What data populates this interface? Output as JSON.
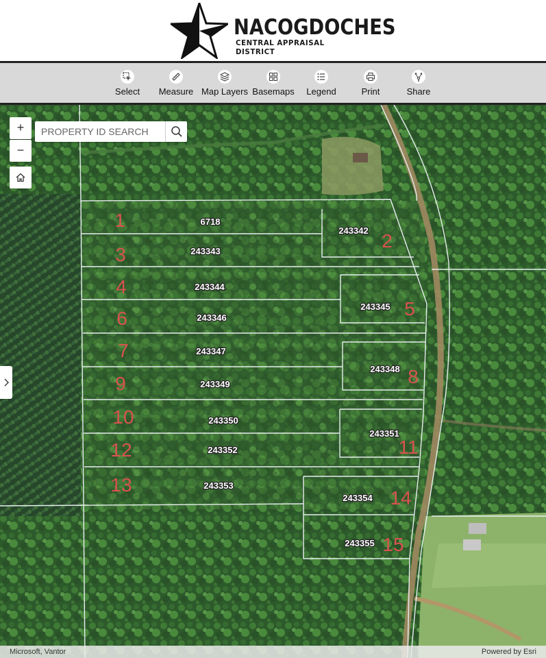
{
  "header": {
    "logo_title": "NACOGDOCHES",
    "logo_subtitle": "CENTRAL APPRAISAL DISTRICT",
    "logo_icon": "texas-star-icon"
  },
  "toolbar": {
    "items": [
      {
        "label": "Select",
        "icon": "select-icon"
      },
      {
        "label": "Measure",
        "icon": "ruler-icon"
      },
      {
        "label": "Map Layers",
        "icon": "layers-icon"
      },
      {
        "label": "Basemaps",
        "icon": "grid-icon"
      },
      {
        "label": "Legend",
        "icon": "list-icon"
      },
      {
        "label": "Print",
        "icon": "printer-icon"
      },
      {
        "label": "Share",
        "icon": "share-icon"
      }
    ]
  },
  "map": {
    "zoom_in_label": "+",
    "zoom_out_label": "−",
    "search_placeholder": "PROPERTY ID SEARCH",
    "parcels": [
      {
        "lot": "1",
        "id": "6718"
      },
      {
        "lot": "2",
        "id": "243342"
      },
      {
        "lot": "3",
        "id": "243343"
      },
      {
        "lot": "4",
        "id": "243344"
      },
      {
        "lot": "5",
        "id": "243345"
      },
      {
        "lot": "6",
        "id": "243346"
      },
      {
        "lot": "7",
        "id": "243347"
      },
      {
        "lot": "8",
        "id": "243348"
      },
      {
        "lot": "9",
        "id": "243349"
      },
      {
        "lot": "10",
        "id": "243350"
      },
      {
        "lot": "11",
        "id": "243351"
      },
      {
        "lot": "12",
        "id": "243352"
      },
      {
        "lot": "13",
        "id": "243353"
      },
      {
        "lot": "14",
        "id": "243354"
      },
      {
        "lot": "15",
        "id": "243355"
      }
    ],
    "attribution_left": "Microsoft, Vantor",
    "attribution_right": "Powered by Esri"
  },
  "colors": {
    "lot_number": "#d9534f",
    "parcel_line": "#e8eef0",
    "toolbar_bg": "#d9d9d9"
  }
}
